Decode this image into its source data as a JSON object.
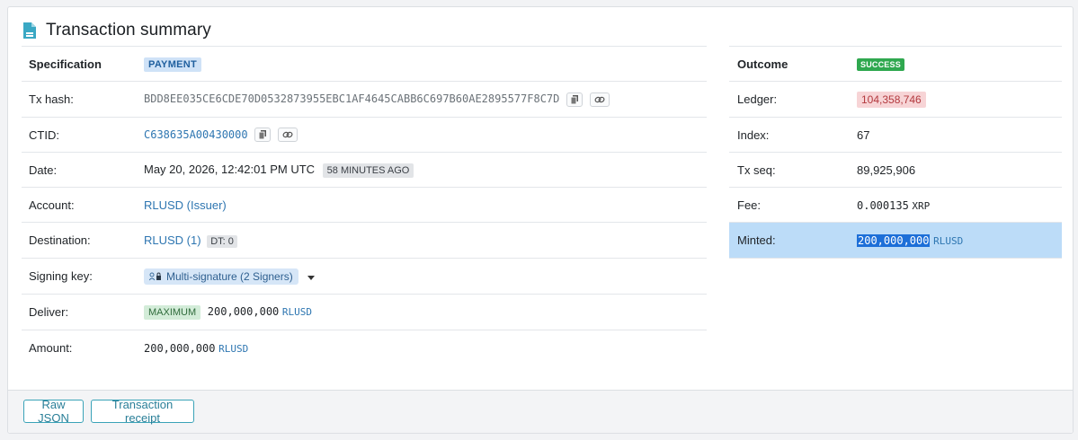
{
  "header": {
    "title": "Transaction summary"
  },
  "left": {
    "specification": {
      "label": "Specification",
      "badge": "PAYMENT"
    },
    "tx_hash": {
      "label": "Tx hash:",
      "value": "BDD8EE035CE6CDE70D0532873955EBC1AF4645CABB6C697B60AE2895577F8C7D"
    },
    "ctid": {
      "label": "CTID:",
      "value": "C638635A00430000"
    },
    "date": {
      "label": "Date:",
      "value": "May 20, 2026, 12:42:01 PM UTC",
      "ago": "58 MINUTES AGO"
    },
    "account": {
      "label": "Account:",
      "value": "RLUSD (Issuer)"
    },
    "destination": {
      "label": "Destination:",
      "value": "RLUSD (1)",
      "dt": "DT: 0"
    },
    "signing_key": {
      "label": "Signing key:",
      "value": "Multi-signature (2 Signers)"
    },
    "deliver": {
      "label": "Deliver:",
      "badge": "MAXIMUM",
      "amount": "200,000,000",
      "currency": "RLUSD"
    },
    "amount": {
      "label": "Amount:",
      "amount": "200,000,000",
      "currency": "RLUSD"
    }
  },
  "right": {
    "outcome": {
      "label": "Outcome",
      "badge": "SUCCESS"
    },
    "ledger": {
      "label": "Ledger:",
      "value": "104,358,746"
    },
    "index": {
      "label": "Index:",
      "value": "67"
    },
    "tx_seq": {
      "label": "Tx seq:",
      "value": "89,925,906"
    },
    "fee": {
      "label": "Fee:",
      "amount": "0.000135",
      "currency": "XRP"
    },
    "minted": {
      "label": "Minted:",
      "amount": "200,000,000",
      "currency": "RLUSD"
    }
  },
  "footer": {
    "raw_json": "Raw JSON",
    "receipt": "Transaction receipt"
  },
  "icons": [
    "document-icon",
    "copy-icon",
    "link-icon",
    "signers-icon",
    "caret-down-icon"
  ],
  "colors": {
    "link": "#2e76b1",
    "success": "#2fa84f",
    "minted_row": "#bcdcf8",
    "selection": "#1d6fd8"
  }
}
